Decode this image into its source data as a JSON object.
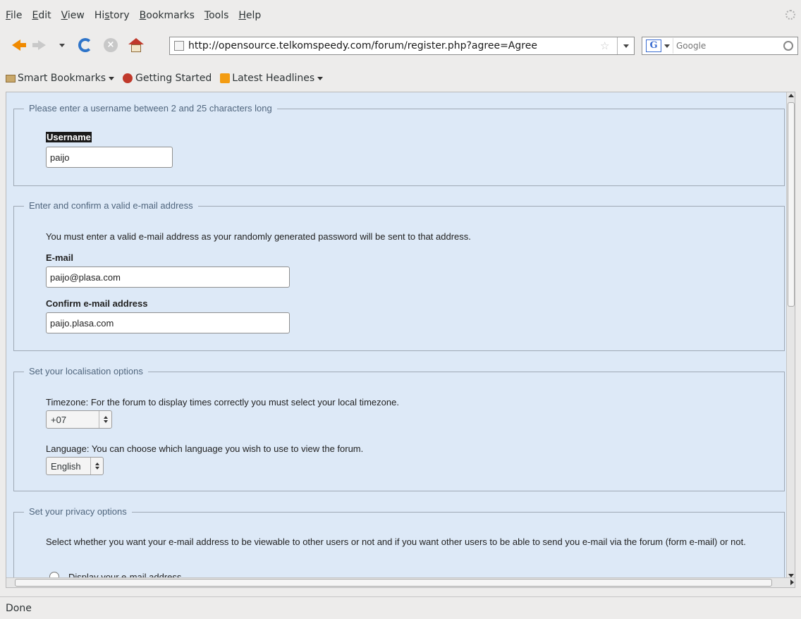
{
  "menu": [
    "File",
    "Edit",
    "View",
    "History",
    "Bookmarks",
    "Tools",
    "Help"
  ],
  "menu_mnemonics": [
    "F",
    "E",
    "V",
    "s",
    "B",
    "T",
    "H"
  ],
  "nav": {
    "url": "http://opensource.telkomspeedy.com/forum/register.php?agree=Agree",
    "search_engine": "G",
    "search_placeholder": "Google"
  },
  "bookmarks": [
    "Smart Bookmarks",
    "Getting Started",
    "Latest Headlines"
  ],
  "form": {
    "username_section": {
      "legend": "Please enter a username between 2 and 25 characters long",
      "label": "Username",
      "value": "paijo"
    },
    "email_section": {
      "legend": "Enter and confirm a valid e-mail address",
      "note": "You must enter a valid e-mail address as your randomly generated password will be sent to that address.",
      "email_label": "E-mail",
      "email_value": "paijo@plasa.com",
      "confirm_label": "Confirm e-mail address",
      "confirm_value": "paijo.plasa.com"
    },
    "locale_section": {
      "legend": "Set your localisation options",
      "timezone_text": "Timezone: For the forum to display times correctly you must select your local timezone.",
      "timezone_value": "+07",
      "language_text": "Language: You can choose which language you wish to use to view the forum.",
      "language_value": "English"
    },
    "privacy_section": {
      "legend": "Set your privacy options",
      "text": "Select whether you want your e-mail address to be viewable to other users or not and if you want other users to be able to send you e-mail via the forum (form e-mail) or not.",
      "option1": "Display your e-mail address."
    }
  },
  "status": "Done"
}
